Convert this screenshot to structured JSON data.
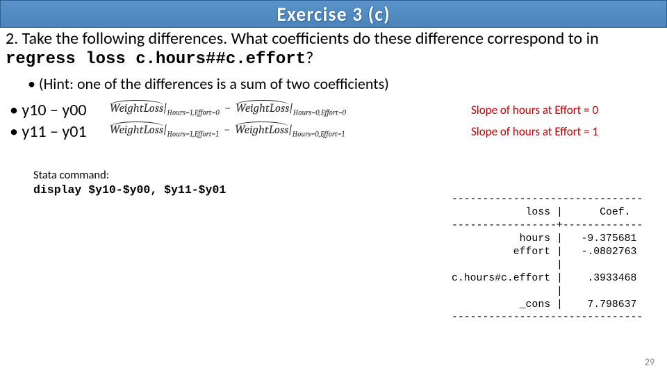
{
  "title": "Exercise 3 (c)",
  "prompt": {
    "lead": "2. Take the following differences. What coefficients do these difference correspond to in ",
    "code": "regress loss c.hours##c.effort",
    "tail": "?"
  },
  "hint": "• (Hint: one of the differences is a sum of two coefficients)",
  "diffs": [
    {
      "bullet": "• y10 – y00",
      "lhs_var": "WeightLoss",
      "lhs_sub": "Hours=1,Effort=0",
      "rhs_var": "WeightLoss",
      "rhs_sub": "Hours=0,Effort=0",
      "slope": "Slope of hours at Effort = 0"
    },
    {
      "bullet": "• y11 – y01",
      "lhs_var": "WeightLoss",
      "lhs_sub": "Hours=1,Effort=1",
      "rhs_var": "WeightLoss",
      "rhs_sub": "Hours=0,Effort=1",
      "slope": "Slope of hours at Effort = 1"
    }
  ],
  "stata": {
    "label": "Stata command:",
    "cmd": "display $y10-$y00, $y11-$y01"
  },
  "coef_table": "-------------------------------\n            loss |      Coef.\n-----------------+-------------\n           hours |   -9.375681\n          effort |   -.0802763\n                 |\nc.hours#c.effort |    .3933468\n                 |\n           _cons |    7.798637\n-------------------------------",
  "page_number": "29",
  "chart_data": {
    "type": "table",
    "title": "Regression coefficients",
    "columns": [
      "loss",
      "Coef."
    ],
    "rows": [
      {
        "loss": "hours",
        "Coef.": -9.375681
      },
      {
        "loss": "effort",
        "Coef.": -0.0802763
      },
      {
        "loss": "c.hours#c.effort",
        "Coef.": 0.3933468
      },
      {
        "loss": "_cons",
        "Coef.": 7.798637
      }
    ]
  }
}
